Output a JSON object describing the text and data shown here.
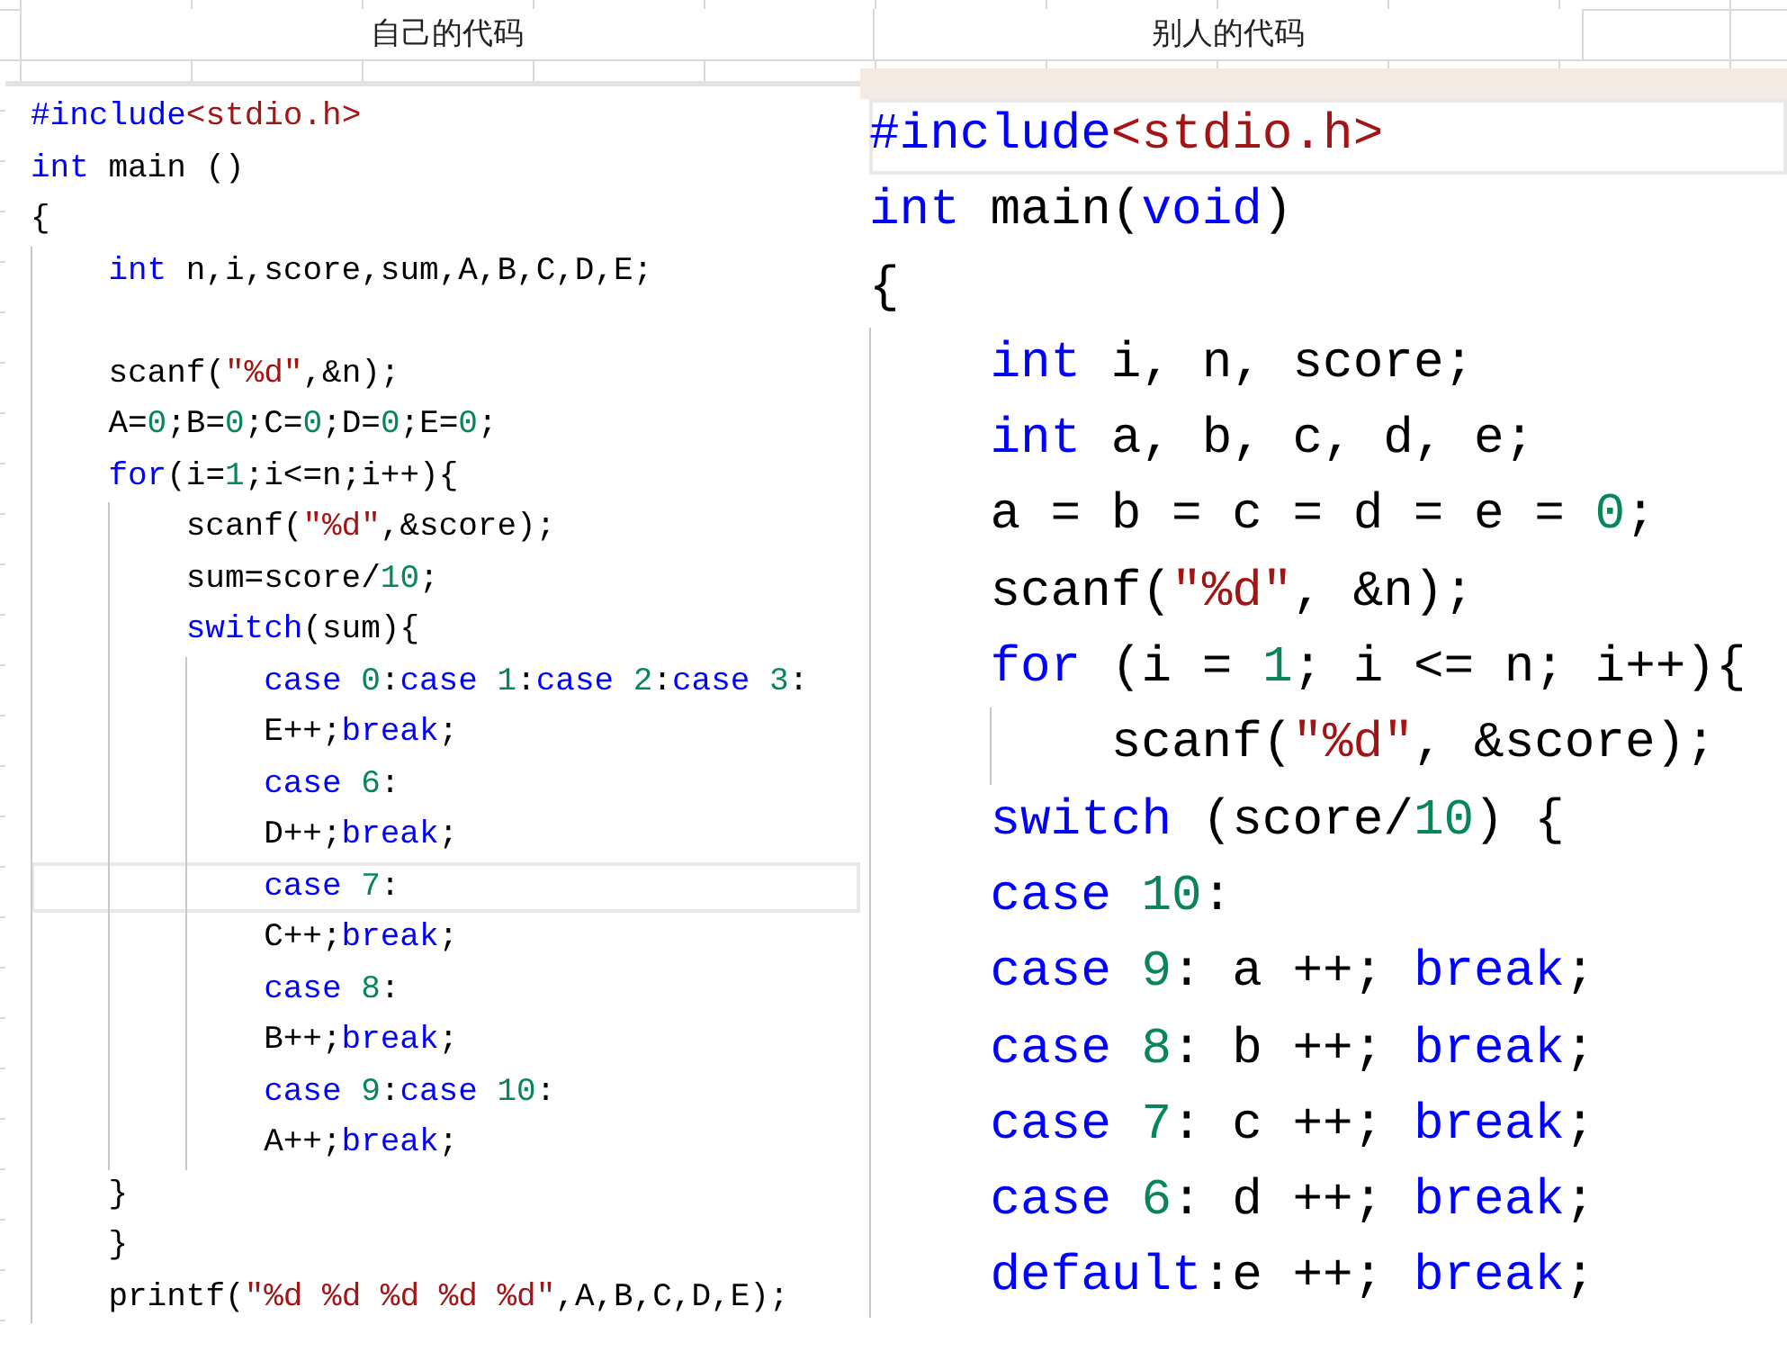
{
  "sheet": {
    "headers": [
      "自己的代码",
      "别人的代码"
    ]
  },
  "panels": [
    {
      "lines": [
        {
          "current": false,
          "tokens": [
            {
              "kind": "directive",
              "text": "#include"
            },
            {
              "kind": "header",
              "text": "<stdio.h>"
            }
          ]
        },
        {
          "current": false,
          "tokens": [
            {
              "kind": "keyword",
              "text": "int"
            },
            {
              "kind": "plain",
              "text": " main ()"
            }
          ]
        },
        {
          "current": false,
          "tokens": [
            {
              "kind": "plain",
              "text": "{"
            }
          ],
          "children": [
            {
              "current": false,
              "tokens": [
                {
                  "kind": "keyword",
                  "text": "int"
                },
                {
                  "kind": "plain",
                  "text": " n,i,score,sum,A,B,C,D,E;"
                }
              ]
            },
            {
              "current": false
            },
            {
              "current": false,
              "tokens": [
                {
                  "kind": "plain",
                  "text": "scanf("
                },
                {
                  "kind": "string",
                  "text": "\"%d\""
                },
                {
                  "kind": "plain",
                  "text": ",&n);"
                }
              ]
            },
            {
              "current": false,
              "tokens": [
                {
                  "kind": "plain",
                  "text": "A="
                },
                {
                  "kind": "number",
                  "text": "0"
                },
                {
                  "kind": "plain",
                  "text": ";B="
                },
                {
                  "kind": "number",
                  "text": "0"
                },
                {
                  "kind": "plain",
                  "text": ";C="
                },
                {
                  "kind": "number",
                  "text": "0"
                },
                {
                  "kind": "plain",
                  "text": ";D="
                },
                {
                  "kind": "number",
                  "text": "0"
                },
                {
                  "kind": "plain",
                  "text": ";E="
                },
                {
                  "kind": "number",
                  "text": "0"
                },
                {
                  "kind": "plain",
                  "text": ";"
                }
              ]
            },
            {
              "current": false,
              "tokens": [
                {
                  "kind": "keyword",
                  "text": "for"
                },
                {
                  "kind": "plain",
                  "text": "(i="
                },
                {
                  "kind": "number",
                  "text": "1"
                },
                {
                  "kind": "plain",
                  "text": ";i<=n;i++){"
                }
              ],
              "children": [
                {
                  "current": false,
                  "tokens": [
                    {
                      "kind": "plain",
                      "text": "scanf("
                    },
                    {
                      "kind": "string",
                      "text": "\"%d\""
                    },
                    {
                      "kind": "plain",
                      "text": ",&score);"
                    }
                  ]
                },
                {
                  "current": false,
                  "tokens": [
                    {
                      "kind": "plain",
                      "text": "sum=score/"
                    },
                    {
                      "kind": "number",
                      "text": "10"
                    },
                    {
                      "kind": "plain",
                      "text": ";"
                    }
                  ]
                },
                {
                  "current": false,
                  "tokens": [
                    {
                      "kind": "keyword",
                      "text": "switch"
                    },
                    {
                      "kind": "plain",
                      "text": "(sum){"
                    }
                  ],
                  "children": [
                    {
                      "current": false,
                      "tokens": [
                        {
                          "kind": "keyword",
                          "text": "case "
                        },
                        {
                          "kind": "number",
                          "text": "0"
                        },
                        {
                          "kind": "plain",
                          "text": ":"
                        },
                        {
                          "kind": "keyword",
                          "text": "case "
                        },
                        {
                          "kind": "number",
                          "text": "1"
                        },
                        {
                          "kind": "plain",
                          "text": ":"
                        },
                        {
                          "kind": "keyword",
                          "text": "case "
                        },
                        {
                          "kind": "number",
                          "text": "2"
                        },
                        {
                          "kind": "plain",
                          "text": ":"
                        },
                        {
                          "kind": "keyword",
                          "text": "case "
                        },
                        {
                          "kind": "number",
                          "text": "3"
                        },
                        {
                          "kind": "plain",
                          "text": ":"
                        }
                      ]
                    },
                    {
                      "current": false,
                      "tokens": [
                        {
                          "kind": "plain",
                          "text": "E++;"
                        },
                        {
                          "kind": "keyword",
                          "text": "break"
                        },
                        {
                          "kind": "plain",
                          "text": ";"
                        }
                      ]
                    },
                    {
                      "current": false,
                      "tokens": [
                        {
                          "kind": "keyword",
                          "text": "case "
                        },
                        {
                          "kind": "number",
                          "text": "6"
                        },
                        {
                          "kind": "plain",
                          "text": ":"
                        }
                      ]
                    },
                    {
                      "current": false,
                      "tokens": [
                        {
                          "kind": "plain",
                          "text": "D++;"
                        },
                        {
                          "kind": "keyword",
                          "text": "break"
                        },
                        {
                          "kind": "plain",
                          "text": ";"
                        }
                      ]
                    },
                    {
                      "current": true,
                      "tokens": [
                        {
                          "kind": "keyword",
                          "text": "case "
                        },
                        {
                          "kind": "number",
                          "text": "7"
                        },
                        {
                          "kind": "plain",
                          "text": ":"
                        }
                      ]
                    },
                    {
                      "current": false,
                      "tokens": [
                        {
                          "kind": "plain",
                          "text": "C++;"
                        },
                        {
                          "kind": "keyword",
                          "text": "break"
                        },
                        {
                          "kind": "plain",
                          "text": ";"
                        }
                      ]
                    },
                    {
                      "current": false,
                      "tokens": [
                        {
                          "kind": "keyword",
                          "text": "case "
                        },
                        {
                          "kind": "number",
                          "text": "8"
                        },
                        {
                          "kind": "plain",
                          "text": ":"
                        }
                      ]
                    },
                    {
                      "current": false,
                      "tokens": [
                        {
                          "kind": "plain",
                          "text": "B++;"
                        },
                        {
                          "kind": "keyword",
                          "text": "break"
                        },
                        {
                          "kind": "plain",
                          "text": ";"
                        }
                      ]
                    },
                    {
                      "current": false,
                      "tokens": [
                        {
                          "kind": "keyword",
                          "text": "case "
                        },
                        {
                          "kind": "number",
                          "text": "9"
                        },
                        {
                          "kind": "plain",
                          "text": ":"
                        },
                        {
                          "kind": "keyword",
                          "text": "case "
                        },
                        {
                          "kind": "number",
                          "text": "10"
                        },
                        {
                          "kind": "plain",
                          "text": ":"
                        }
                      ]
                    },
                    {
                      "current": false,
                      "tokens": [
                        {
                          "kind": "plain",
                          "text": "A++;"
                        },
                        {
                          "kind": "keyword",
                          "text": "break"
                        },
                        {
                          "kind": "plain",
                          "text": ";"
                        }
                      ]
                    }
                  ]
                }
              ]
            },
            {
              "current": false,
              "tokens": [
                {
                  "kind": "plain",
                  "text": "}"
                }
              ]
            },
            {
              "current": false,
              "tokens": [
                {
                  "kind": "plain",
                  "text": "}"
                }
              ]
            },
            {
              "current": false,
              "tokens": [
                {
                  "kind": "plain",
                  "text": "printf("
                },
                {
                  "kind": "string",
                  "text": "\"%d %d %d %d %d\""
                },
                {
                  "kind": "plain",
                  "text": ",A,B,C,D,E);"
                }
              ]
            }
          ]
        }
      ]
    },
    {
      "lines": [
        {
          "current": true,
          "tokens": [
            {
              "kind": "directive",
              "text": "#include"
            },
            {
              "kind": "header",
              "text": "<stdio.h>"
            }
          ]
        },
        {
          "current": false,
          "tokens": [
            {
              "kind": "keyword",
              "text": "int"
            },
            {
              "kind": "plain",
              "text": " main("
            },
            {
              "kind": "keyword",
              "text": "void"
            },
            {
              "kind": "plain",
              "text": ")"
            }
          ]
        },
        {
          "current": false,
          "tokens": [
            {
              "kind": "plain",
              "text": "{"
            }
          ],
          "children": [
            {
              "current": false,
              "tokens": [
                {
                  "kind": "keyword",
                  "text": "int"
                },
                {
                  "kind": "plain",
                  "text": " i, n, score;"
                }
              ]
            },
            {
              "current": false,
              "tokens": [
                {
                  "kind": "keyword",
                  "text": "int"
                },
                {
                  "kind": "plain",
                  "text": " a, b, c, d, e;"
                }
              ]
            },
            {
              "current": false,
              "tokens": [
                {
                  "kind": "plain",
                  "text": "a = b = c = d = e = "
                },
                {
                  "kind": "number",
                  "text": "0"
                },
                {
                  "kind": "plain",
                  "text": ";"
                }
              ]
            },
            {
              "current": false,
              "tokens": [
                {
                  "kind": "plain",
                  "text": "scanf("
                },
                {
                  "kind": "string",
                  "text": "\"%d\""
                },
                {
                  "kind": "plain",
                  "text": ", &n);"
                }
              ]
            },
            {
              "current": false,
              "tokens": [
                {
                  "kind": "keyword",
                  "text": "for"
                },
                {
                  "kind": "plain",
                  "text": " (i = "
                },
                {
                  "kind": "number",
                  "text": "1"
                },
                {
                  "kind": "plain",
                  "text": "; i <= n; i++){"
                }
              ],
              "children": [
                {
                  "current": false,
                  "tokens": [
                    {
                      "kind": "plain",
                      "text": "scanf("
                    },
                    {
                      "kind": "string",
                      "text": "\"%d\""
                    },
                    {
                      "kind": "plain",
                      "text": ", &score);"
                    }
                  ]
                }
              ]
            },
            {
              "current": false,
              "tokens": [
                {
                  "kind": "keyword",
                  "text": "switch"
                },
                {
                  "kind": "plain",
                  "text": " (score/"
                },
                {
                  "kind": "number",
                  "text": "10"
                },
                {
                  "kind": "plain",
                  "text": ") {"
                }
              ]
            },
            {
              "current": false,
              "tokens": [
                {
                  "kind": "keyword",
                  "text": "case "
                },
                {
                  "kind": "number",
                  "text": "10"
                },
                {
                  "kind": "plain",
                  "text": ":"
                }
              ]
            },
            {
              "current": false,
              "tokens": [
                {
                  "kind": "keyword",
                  "text": "case "
                },
                {
                  "kind": "number",
                  "text": "9"
                },
                {
                  "kind": "plain",
                  "text": ": a ++; "
                },
                {
                  "kind": "keyword",
                  "text": "break"
                },
                {
                  "kind": "plain",
                  "text": ";"
                }
              ]
            },
            {
              "current": false,
              "tokens": [
                {
                  "kind": "keyword",
                  "text": "case "
                },
                {
                  "kind": "number",
                  "text": "8"
                },
                {
                  "kind": "plain",
                  "text": ": b ++; "
                },
                {
                  "kind": "keyword",
                  "text": "break"
                },
                {
                  "kind": "plain",
                  "text": ";"
                }
              ]
            },
            {
              "current": false,
              "tokens": [
                {
                  "kind": "keyword",
                  "text": "case "
                },
                {
                  "kind": "number",
                  "text": "7"
                },
                {
                  "kind": "plain",
                  "text": ": c ++; "
                },
                {
                  "kind": "keyword",
                  "text": "break"
                },
                {
                  "kind": "plain",
                  "text": ";"
                }
              ]
            },
            {
              "current": false,
              "tokens": [
                {
                  "kind": "keyword",
                  "text": "case "
                },
                {
                  "kind": "number",
                  "text": "6"
                },
                {
                  "kind": "plain",
                  "text": ": d ++; "
                },
                {
                  "kind": "keyword",
                  "text": "break"
                },
                {
                  "kind": "plain",
                  "text": ";"
                }
              ]
            },
            {
              "current": false,
              "tokens": [
                {
                  "kind": "keyword",
                  "text": "default"
                },
                {
                  "kind": "plain",
                  "text": ":e ++; "
                },
                {
                  "kind": "keyword",
                  "text": "break"
                },
                {
                  "kind": "plain",
                  "text": ";"
                }
              ]
            }
          ]
        }
      ]
    }
  ]
}
